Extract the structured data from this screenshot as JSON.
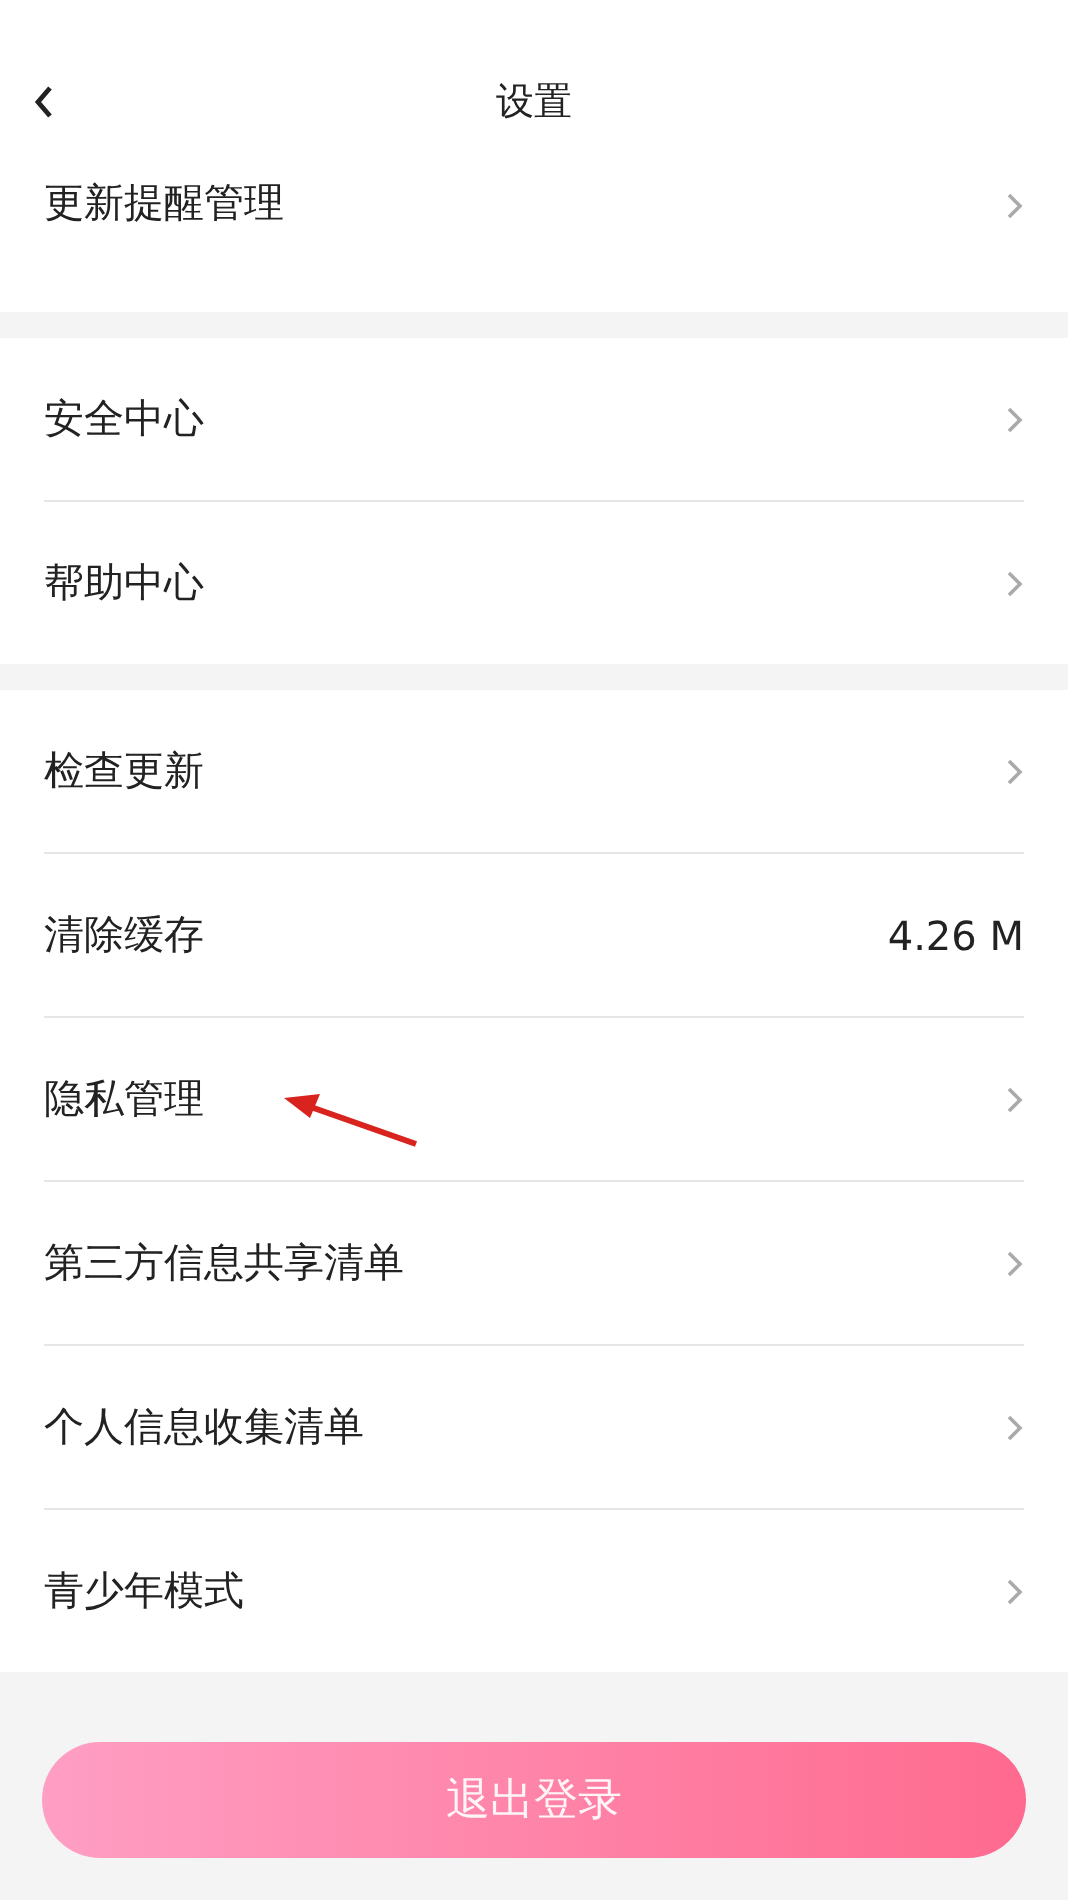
{
  "header": {
    "title": "设置"
  },
  "sections": [
    {
      "items": [
        {
          "label": "更新提醒管理",
          "kind": "link"
        }
      ]
    },
    {
      "items": [
        {
          "label": "安全中心",
          "kind": "link"
        },
        {
          "label": "帮助中心",
          "kind": "link"
        }
      ]
    },
    {
      "items": [
        {
          "label": "检查更新",
          "kind": "link"
        },
        {
          "label": "清除缓存",
          "kind": "value",
          "value": "4.26 M"
        },
        {
          "label": "隐私管理",
          "kind": "link",
          "annotated": true
        },
        {
          "label": "第三方信息共享清单",
          "kind": "link"
        },
        {
          "label": "个人信息收集清单",
          "kind": "link"
        },
        {
          "label": "青少年模式",
          "kind": "link"
        }
      ]
    }
  ],
  "logout_button": {
    "label": "退出登录"
  }
}
